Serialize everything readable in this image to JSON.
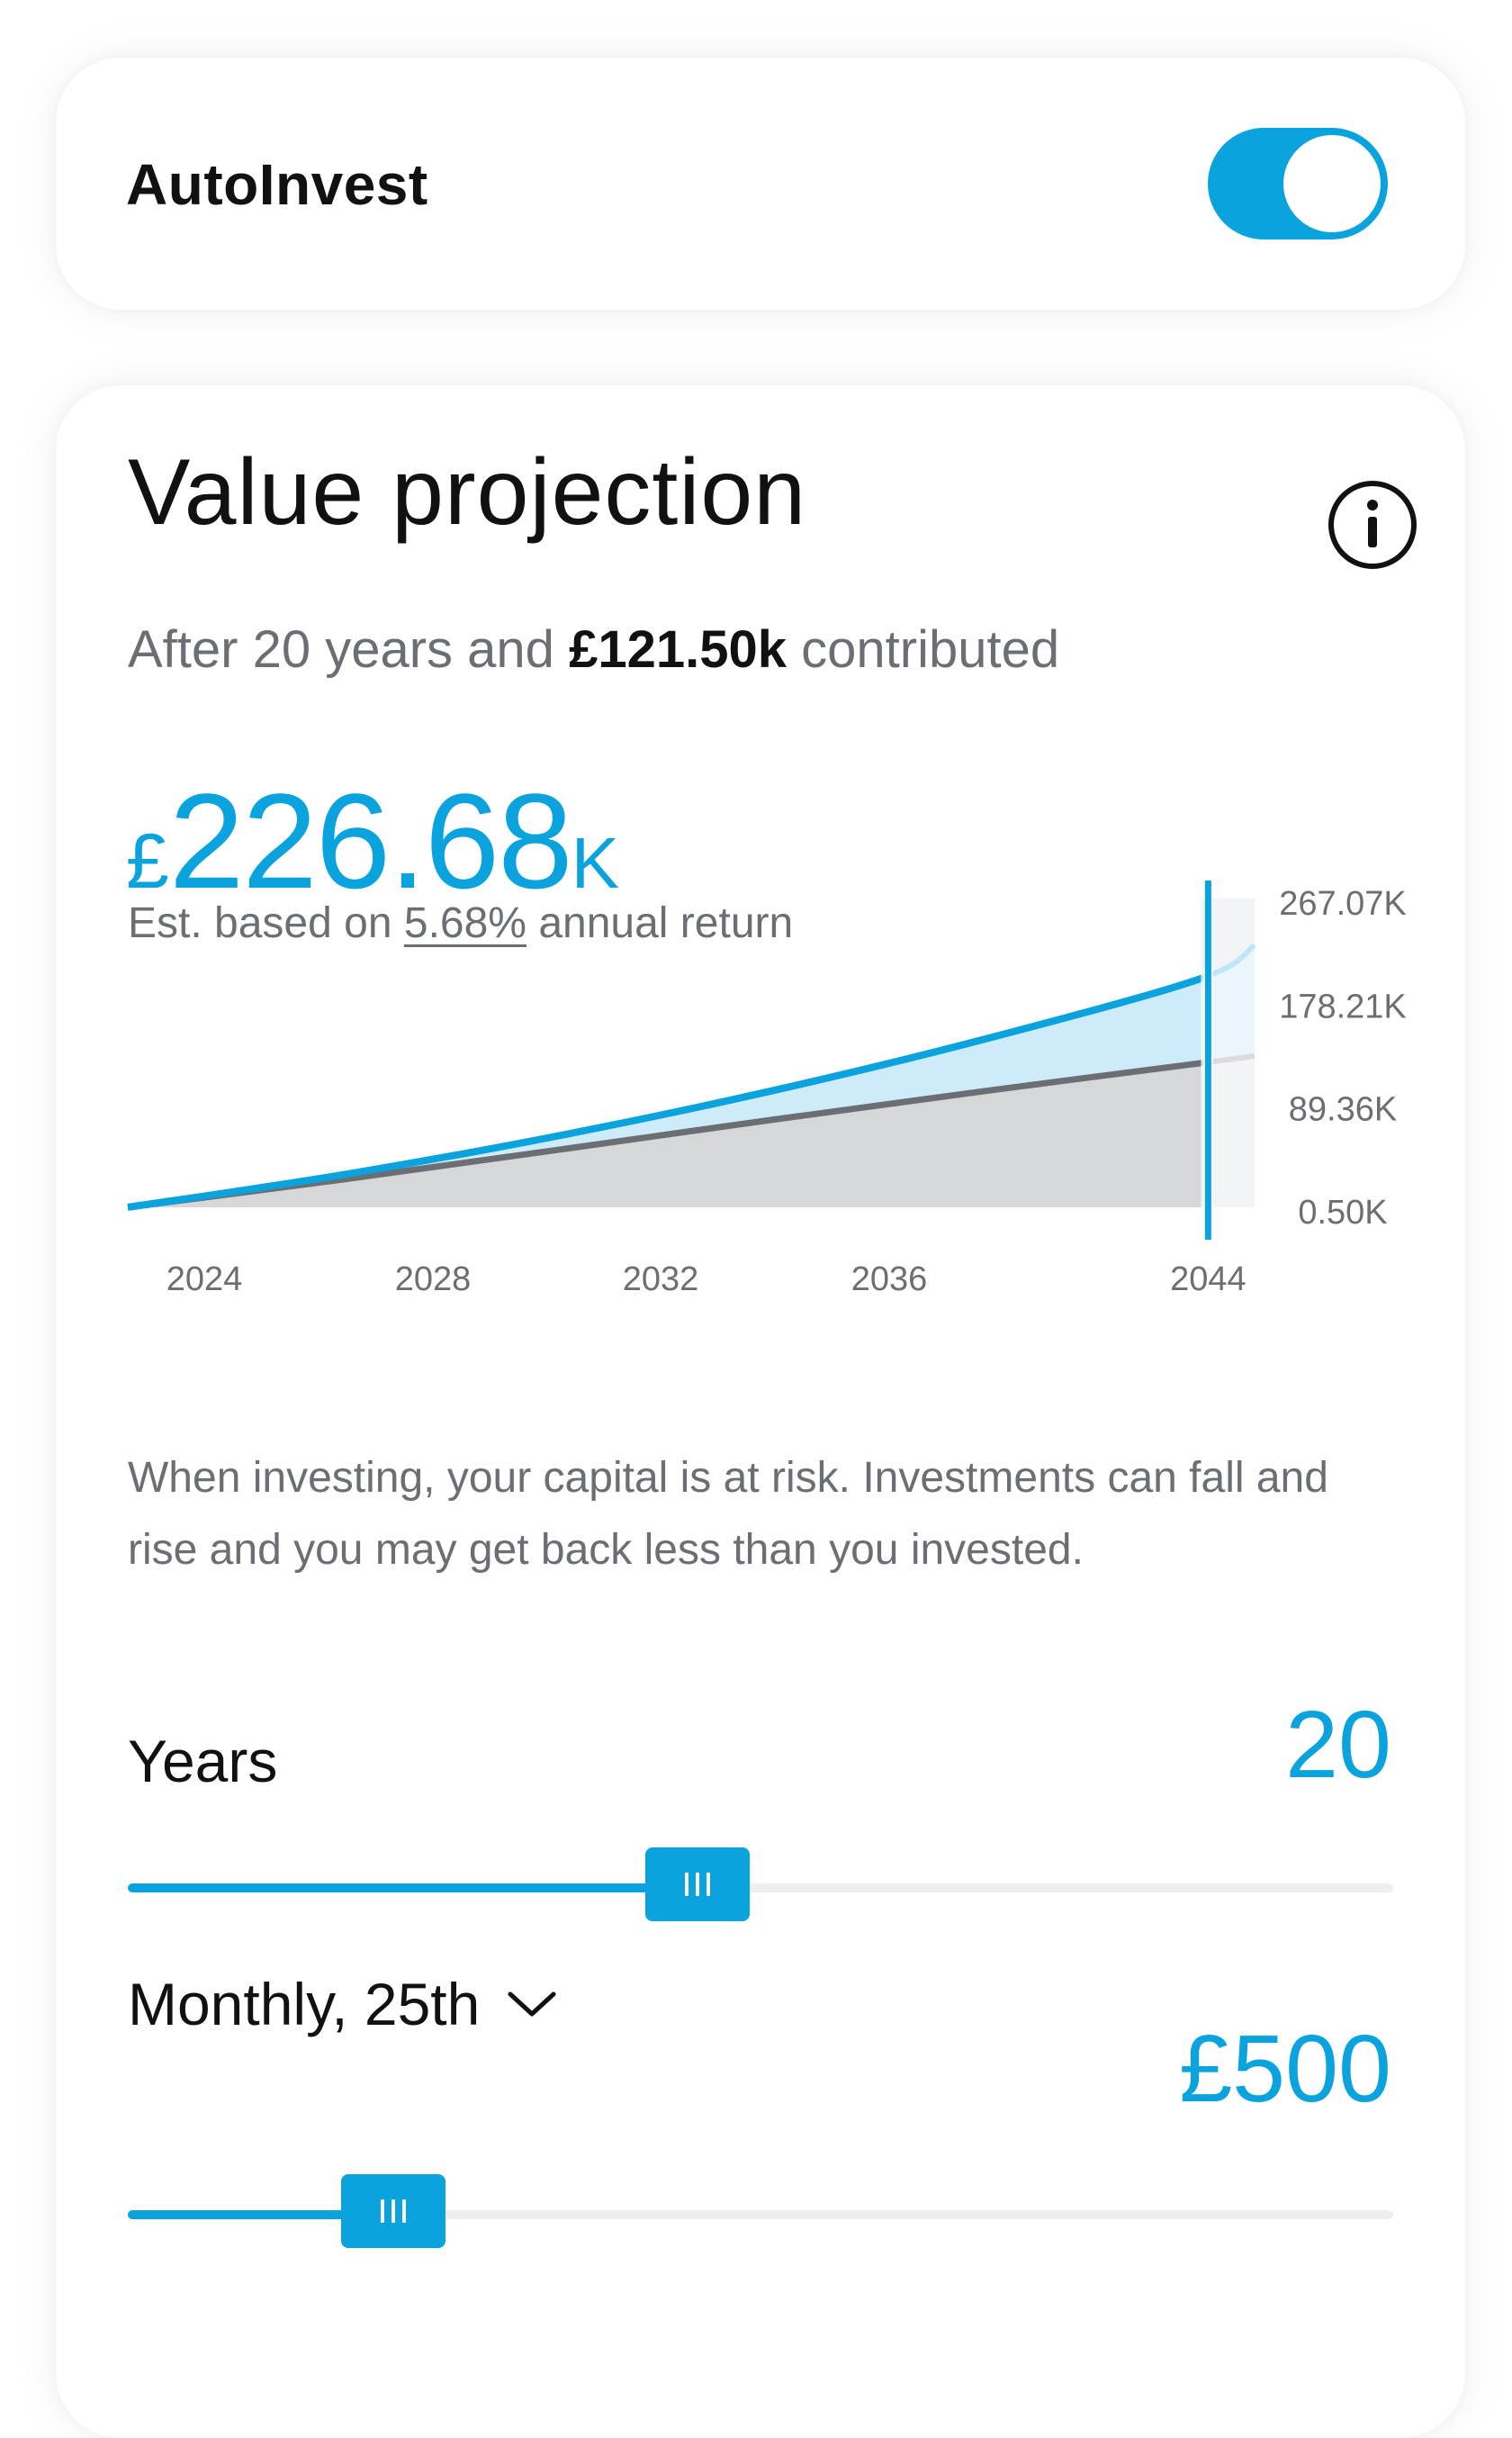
{
  "autoinvest": {
    "title": "AutoInvest",
    "enabled": true
  },
  "projection": {
    "title": "Value projection",
    "info_icon": "info-icon",
    "subtitle_prefix": "After 20 years and",
    "subtitle_amount": "£121.50k",
    "subtitle_suffix": "contributed",
    "value_currency": "£",
    "value_number": "226.68",
    "value_unit": "K",
    "est_prefix": "Est. based on",
    "est_rate": "5.68%",
    "est_suffix": "annual return",
    "disclaimer": "When investing, your capital is at risk. Investments can fall and rise and you may get back less than you invested."
  },
  "chart_data": {
    "type": "area",
    "x": [
      2024,
      2028,
      2032,
      2036,
      2040,
      2044,
      2045
    ],
    "x_tick_labels": [
      "2024",
      "2028",
      "2032",
      "2036",
      "2044"
    ],
    "y_tick_labels": [
      "267.07K",
      "178.21K",
      "89.36K",
      "0.50K"
    ],
    "y_ticks": [
      267.07,
      178.21,
      89.36,
      0.5
    ],
    "ylim": [
      0.5,
      267.07
    ],
    "selected_x": 2044,
    "series": [
      {
        "values": [
          0.5,
          28.5,
          62.0,
          101.0,
          146.0,
          198.0,
          226.68
        ],
        "color": "#0aa3dd"
      },
      {
        "values": [
          0.5,
          24.5,
          50.0,
          76.0,
          101.0,
          125.0,
          131.0
        ],
        "color": "#6b6e73"
      }
    ]
  },
  "years": {
    "label": "Years",
    "value": "20",
    "fraction": 0.45
  },
  "contribution": {
    "frequency": "Monthly, 25th",
    "frequency_icon": "chevron-down-icon",
    "value": "£500",
    "fraction": 0.21
  },
  "colors": {
    "accent": "#0aa3dd",
    "text": "#111111",
    "muted": "#6b6e73"
  }
}
